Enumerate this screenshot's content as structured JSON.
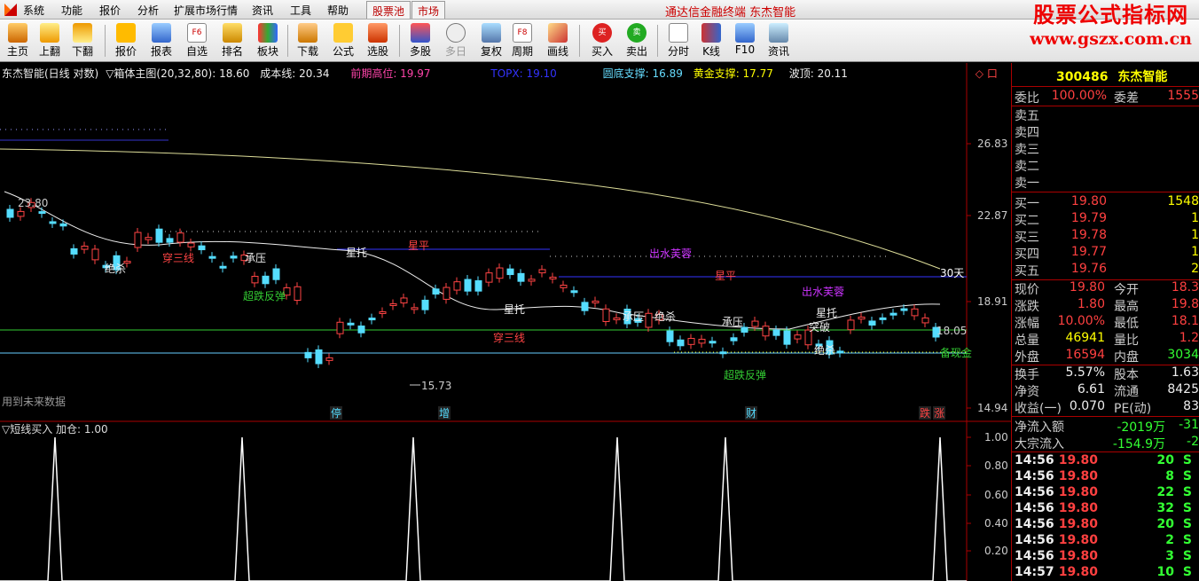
{
  "menu": {
    "items": [
      "系统",
      "功能",
      "报价",
      "分析",
      "扩展市场行情",
      "资讯",
      "工具",
      "帮助"
    ],
    "tabs": [
      "股票池",
      "市场"
    ],
    "banner": "通达信金融终端  东杰智能"
  },
  "brand": {
    "line1": "股票公式指标网",
    "line2": "www.gszx.com.cn"
  },
  "toolbar": {
    "buttons": [
      "主页",
      "上翻",
      "下翻",
      "报价",
      "报表",
      "自选",
      "排名",
      "板块",
      "下载",
      "公式",
      "选股",
      "多股",
      "多日",
      "复权",
      "周期",
      "画线",
      "买入",
      "卖出",
      "分时",
      "K线",
      "F10",
      "资讯"
    ]
  },
  "chart": {
    "header": {
      "name": "东杰智能(日线 对数)",
      "indicator": "▽箱体主图(20,32,80)",
      "value": ": 18.60",
      "cost_line": "成本线: 20.34",
      "prev_high": "前期高位: 19.97",
      "topx": "TOPX: 19.10",
      "round_bottom": "圆底支撑: 16.89",
      "golden": "黄金支撑: 17.77",
      "wave_top": "波顶: 20.11",
      "flags": "◇ 口"
    },
    "price_axis": [
      "26.83",
      "22.87",
      "18.91",
      "14.94"
    ],
    "sub_axis": [
      "1.00",
      "0.80",
      "0.60",
      "0.40",
      "0.20"
    ],
    "labels": {
      "high_mark": "23.80",
      "low_mark": "15.73",
      "cur_mark": "18.05",
      "right_30": "30天",
      "future": "用到未来数据",
      "reserve": "备现金"
    },
    "signals": [
      "绝杀",
      "穿三线",
      "承压",
      "超跌反弹",
      "星托",
      "星平",
      "出水芙蓉",
      "星平",
      "承压",
      "绝杀",
      "承压",
      "超跌反弹",
      "出水芙蓉",
      "星托",
      "突破",
      "绝杀",
      "穿三线",
      "星托"
    ],
    "bottom_marks": [
      "停",
      "增",
      "财",
      "跌",
      "涨"
    ],
    "sub_title": "▽短线买入  加仓: 1.00"
  },
  "panel": {
    "code": "300486",
    "name": "东杰智能",
    "commit_ratio_label": "委比",
    "commit_ratio": "100.00%",
    "commit_diff_label": "委差",
    "commit_diff": "1555",
    "sells": [
      {
        "label": "卖五"
      },
      {
        "label": "卖四"
      },
      {
        "label": "卖三"
      },
      {
        "label": "卖二"
      },
      {
        "label": "卖一"
      }
    ],
    "buys": [
      {
        "label": "买一",
        "price": "19.80",
        "vol": "1548"
      },
      {
        "label": "买二",
        "price": "19.79",
        "vol": "1"
      },
      {
        "label": "买三",
        "price": "19.78",
        "vol": "1"
      },
      {
        "label": "买四",
        "price": "19.77",
        "vol": "1"
      },
      {
        "label": "买五",
        "price": "19.76",
        "vol": "2"
      }
    ],
    "stats": [
      {
        "l1": "现价",
        "v1": "19.80",
        "l2": "今开",
        "v2": "18.3"
      },
      {
        "l1": "涨跌",
        "v1": "1.80",
        "l2": "最高",
        "v2": "19.8"
      },
      {
        "l1": "涨幅",
        "v1": "10.00%",
        "l2": "最低",
        "v2": "18.1"
      },
      {
        "l1": "总量",
        "v1": "46941",
        "l2": "量比",
        "v2": "1.2"
      },
      {
        "l1": "外盘",
        "v1": "16594",
        "l2": "内盘",
        "v2": "3034"
      }
    ],
    "stats2": [
      {
        "l1": "换手",
        "v1": "5.57%",
        "l2": "股本",
        "v2": "1.63"
      },
      {
        "l1": "净资",
        "v1": "6.61",
        "l2": "流通",
        "v2": "8425"
      },
      {
        "l1": "收益(一)",
        "v1": "0.070",
        "l2": "PE(动)",
        "v2": "83"
      }
    ],
    "flow": [
      {
        "l": "净流入额",
        "v1": "-2019万",
        "v2": "-31"
      },
      {
        "l": "大宗流入",
        "v1": "-154.9万",
        "v2": "-2"
      }
    ],
    "ticks": [
      {
        "t": "14:56",
        "p": "19.80",
        "v": "20",
        "s": "S"
      },
      {
        "t": "14:56",
        "p": "19.80",
        "v": "8",
        "s": "S"
      },
      {
        "t": "14:56",
        "p": "19.80",
        "v": "22",
        "s": "S"
      },
      {
        "t": "14:56",
        "p": "19.80",
        "v": "32",
        "s": "S"
      },
      {
        "t": "14:56",
        "p": "19.80",
        "v": "20",
        "s": "S"
      },
      {
        "t": "14:56",
        "p": "19.80",
        "v": "2",
        "s": "S"
      },
      {
        "t": "14:56",
        "p": "19.80",
        "v": "3",
        "s": "S"
      },
      {
        "t": "14:57",
        "p": "19.80",
        "v": "10",
        "s": "S"
      }
    ]
  }
}
